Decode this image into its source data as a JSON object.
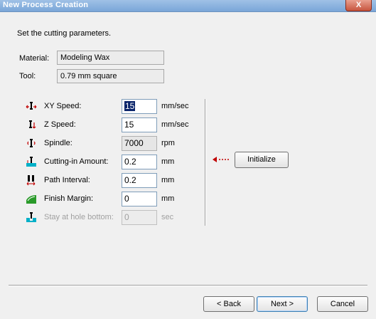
{
  "window": {
    "title": "New Process Creation",
    "close_label": "X"
  },
  "instruction": "Set the cutting parameters.",
  "material": {
    "label": "Material:",
    "value": "Modeling Wax"
  },
  "tool": {
    "label": "Tool:",
    "value": "0.79 mm square"
  },
  "params": {
    "xy_speed": {
      "label": "XY Speed:",
      "value": "15",
      "unit": "mm/sec",
      "icon": "xy-speed-icon"
    },
    "z_speed": {
      "label": "Z Speed:",
      "value": "15",
      "unit": "mm/sec",
      "icon": "z-speed-icon"
    },
    "spindle": {
      "label": "Spindle:",
      "value": "7000",
      "unit": "rpm",
      "icon": "spindle-icon"
    },
    "cutting_in": {
      "label": "Cutting-in Amount:",
      "value": "0.2",
      "unit": "mm",
      "icon": "cutting-in-icon"
    },
    "path_interval": {
      "label": "Path Interval:",
      "value": "0.2",
      "unit": "mm",
      "icon": "path-interval-icon"
    },
    "finish_margin": {
      "label": "Finish Margin:",
      "value": "0",
      "unit": "mm",
      "icon": "finish-margin-icon"
    },
    "stay_hole": {
      "label": "Stay at hole bottom:",
      "value": "0",
      "unit": "sec",
      "icon": "stay-hole-icon"
    }
  },
  "initialize_label": "Initialize",
  "buttons": {
    "back": "< Back",
    "next": "Next >",
    "cancel": "Cancel"
  },
  "colors": {
    "accent_red": "#c00000",
    "icon_cyan": "#00b0c8",
    "icon_green": "#2a9a2a"
  }
}
